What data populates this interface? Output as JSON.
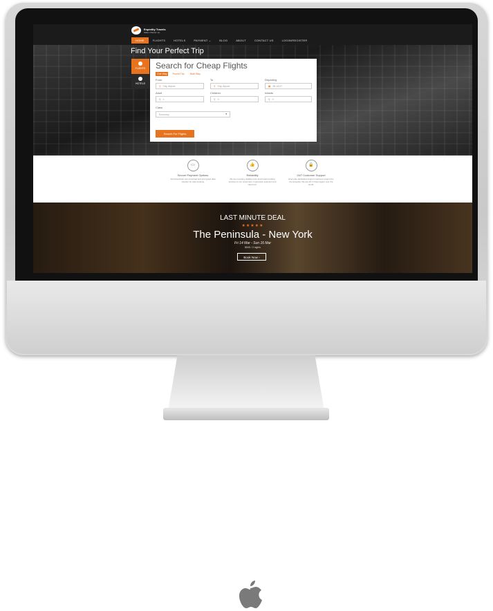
{
  "brand": {
    "name": "Expedity Travels",
    "tagline": "Make it Better Up"
  },
  "nav": {
    "items": [
      "HOME",
      "FLIGHTS",
      "HOTELS",
      "PAYMENT ⌄",
      "BLOG",
      "ABOUT",
      "CONTACT US",
      "LOGIN/REGISTER"
    ]
  },
  "hero": {
    "title": "Find Your Perfect Trip"
  },
  "tabs": [
    {
      "label": "FLIGHTS",
      "icon": "plane-icon"
    },
    {
      "label": "HOTELS",
      "icon": "bed-icon"
    }
  ],
  "search": {
    "title": "Search for Cheap Flights",
    "trip_types": [
      "One Way",
      "Round Trip",
      "Multi Way"
    ],
    "from_label": "From",
    "from_placeholder": "City, Airport",
    "to_label": "To",
    "to_placeholder": "City, Airport",
    "departing_label": "Departing",
    "departing_value": "28-10/17",
    "adult_label": "Adult",
    "adult_value": "1",
    "children_label": "Children",
    "children_value": "0",
    "infants_label": "Infants",
    "infants_value": "0",
    "class_label": "Class",
    "class_value": "Economy",
    "button": "Search For Flights"
  },
  "features": [
    {
      "title": "Secure Payment Options",
      "desc": "All transactions are protected and encrypted data transfer for safe booking",
      "icon": "card-icon"
    },
    {
      "title": "Reliability",
      "desc": "We are covering reliable tours and hotels booking services to our customers. Impressive selection and rated out.",
      "icon": "thumbs-up-icon"
    },
    {
      "title": "24/7 Customer Support",
      "desc": "Everyday dedicated support customer support by the Expedity. We are #1 in travel agent over the world.",
      "icon": "lock-icon"
    }
  ],
  "deal": {
    "kicker": "LAST MINUTE DEAL",
    "stars": "★★★★★",
    "hotel": "The Peninsula - New York",
    "dates": "Fri 14 Mar - Sun 16 Mar",
    "price": "$545 / 2 nights",
    "button": "Book Now ›"
  },
  "colors": {
    "accent": "#e8731f"
  }
}
